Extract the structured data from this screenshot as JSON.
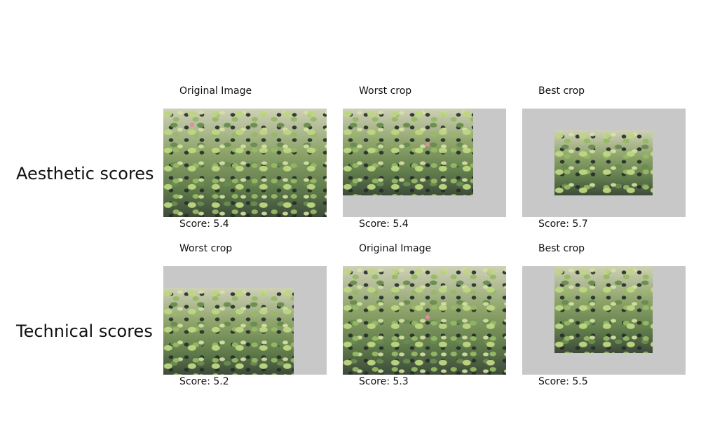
{
  "rows": [
    {
      "label": "Aesthetic scores",
      "panels": [
        {
          "caption": "Original Image",
          "score": "Score: 5.4"
        },
        {
          "caption": "Worst crop",
          "score": "Score: 5.4"
        },
        {
          "caption": "Best crop",
          "score": "Score: 5.7"
        }
      ]
    },
    {
      "label": "Technical scores",
      "panels": [
        {
          "caption": "Worst crop",
          "score": "Score: 5.2"
        },
        {
          "caption": "Original Image",
          "score": "Score: 5.3"
        },
        {
          "caption": "Best crop",
          "score": "Score: 5.5"
        }
      ]
    }
  ],
  "colors": {
    "padding": "#c8c8c8",
    "flower": "#e58aa6"
  }
}
